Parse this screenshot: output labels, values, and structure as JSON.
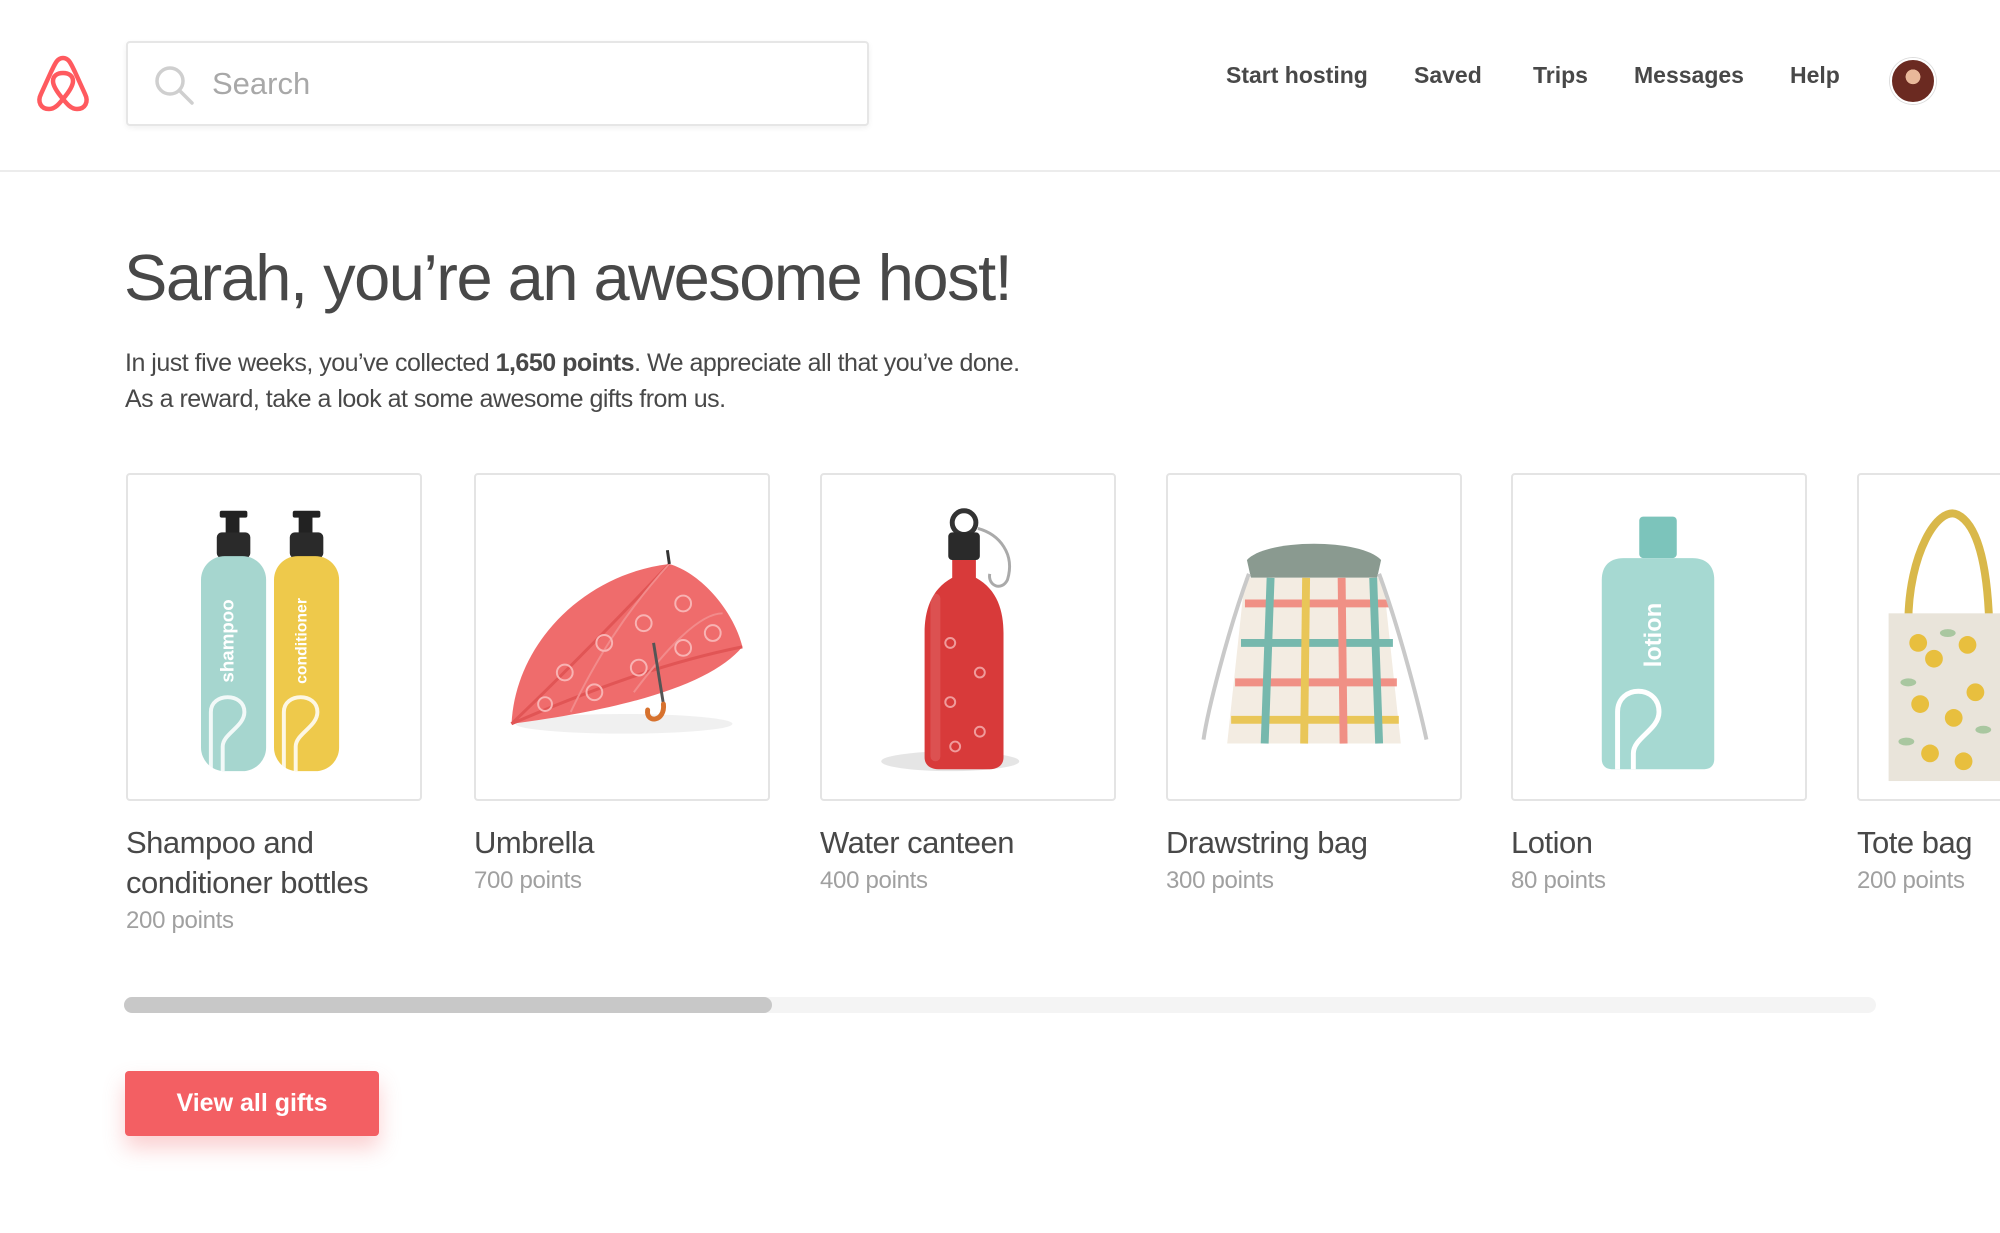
{
  "header": {
    "search_placeholder": "Search",
    "nav": [
      {
        "label": "Start hosting"
      },
      {
        "label": "Saved"
      },
      {
        "label": "Trips"
      },
      {
        "label": "Messages"
      },
      {
        "label": "Help"
      }
    ]
  },
  "main": {
    "title": "Sarah, you’re an awesome host!",
    "intro_before": "In just five weeks, you’ve collected ",
    "intro_points": "1,650 points",
    "intro_after": ". We appreciate all that you’ve done.",
    "intro_line2": "As a reward, take a look at some awesome gifts from us.",
    "gifts": [
      {
        "name": "Shampoo and conditioner bottles",
        "points": "200 points",
        "icon": "shampoo-conditioner-bottles"
      },
      {
        "name": "Umbrella",
        "points": "700 points",
        "icon": "umbrella"
      },
      {
        "name": "Water canteen",
        "points": "400 points",
        "icon": "water-canteen"
      },
      {
        "name": "Drawstring bag",
        "points": "300 points",
        "icon": "drawstring-bag"
      },
      {
        "name": "Lotion",
        "points": "80 points",
        "icon": "lotion-bottle"
      },
      {
        "name": "Tote bag",
        "points": "200 points",
        "icon": "tote-bag"
      }
    ],
    "bottle_labels": {
      "shampoo": "shampoo",
      "conditioner": "conditioner",
      "lotion": "lotion"
    },
    "scroll_position": 0.37,
    "cta_label": "View all gifts"
  },
  "colors": {
    "brand": "#ff5a5f",
    "cta": "#f35f63",
    "text": "#484848",
    "muted": "#a0a0a0"
  }
}
